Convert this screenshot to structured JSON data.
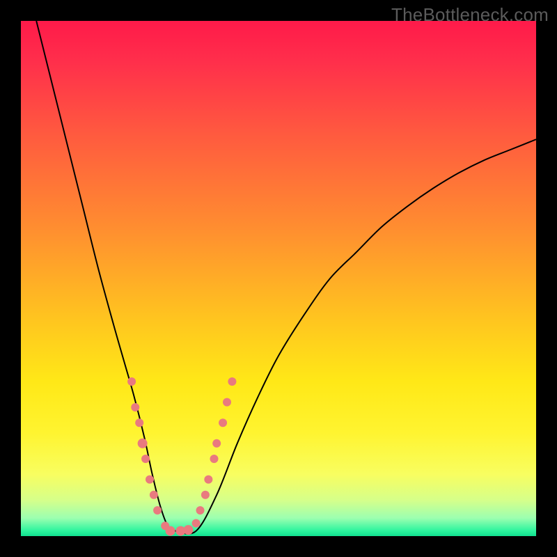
{
  "watermark": "TheBottleneck.com",
  "chart_data": {
    "type": "line",
    "title": "",
    "xlabel": "",
    "ylabel": "",
    "xlim": [
      0,
      100
    ],
    "ylim": [
      0,
      100
    ],
    "curve": {
      "x": [
        3,
        6,
        9,
        12,
        15,
        18,
        20,
        22,
        24,
        25.5,
        27,
        28.5,
        30,
        34,
        38,
        42,
        46,
        50,
        55,
        60,
        65,
        70,
        75,
        80,
        85,
        90,
        95,
        100
      ],
      "y": [
        100,
        88,
        76,
        64,
        52,
        41,
        34,
        27,
        19,
        12,
        6,
        2,
        1,
        1,
        8,
        18,
        27,
        35,
        43,
        50,
        55,
        60,
        64,
        67.5,
        70.5,
        73,
        75,
        77
      ]
    },
    "markers": [
      {
        "x": 21.5,
        "y": 30,
        "r": 6
      },
      {
        "x": 22.2,
        "y": 25,
        "r": 6
      },
      {
        "x": 23,
        "y": 22,
        "r": 6
      },
      {
        "x": 23.6,
        "y": 18,
        "r": 7
      },
      {
        "x": 24.2,
        "y": 15,
        "r": 6
      },
      {
        "x": 25,
        "y": 11,
        "r": 6
      },
      {
        "x": 25.8,
        "y": 8,
        "r": 6
      },
      {
        "x": 26.5,
        "y": 5,
        "r": 6
      },
      {
        "x": 28,
        "y": 2,
        "r": 6
      },
      {
        "x": 29,
        "y": 1,
        "r": 7
      },
      {
        "x": 31,
        "y": 1,
        "r": 7
      },
      {
        "x": 32.5,
        "y": 1.2,
        "r": 7
      },
      {
        "x": 34,
        "y": 2.5,
        "r": 6
      },
      {
        "x": 34.8,
        "y": 5,
        "r": 6
      },
      {
        "x": 35.8,
        "y": 8,
        "r": 6
      },
      {
        "x": 36.4,
        "y": 11,
        "r": 6
      },
      {
        "x": 37.5,
        "y": 15,
        "r": 6
      },
      {
        "x": 38,
        "y": 18,
        "r": 6
      },
      {
        "x": 39.2,
        "y": 22,
        "r": 6
      },
      {
        "x": 40,
        "y": 26,
        "r": 6
      },
      {
        "x": 41,
        "y": 30,
        "r": 6
      }
    ],
    "marker_color": "#e97a7f",
    "curve_color": "#000000",
    "curve_width": 2
  }
}
